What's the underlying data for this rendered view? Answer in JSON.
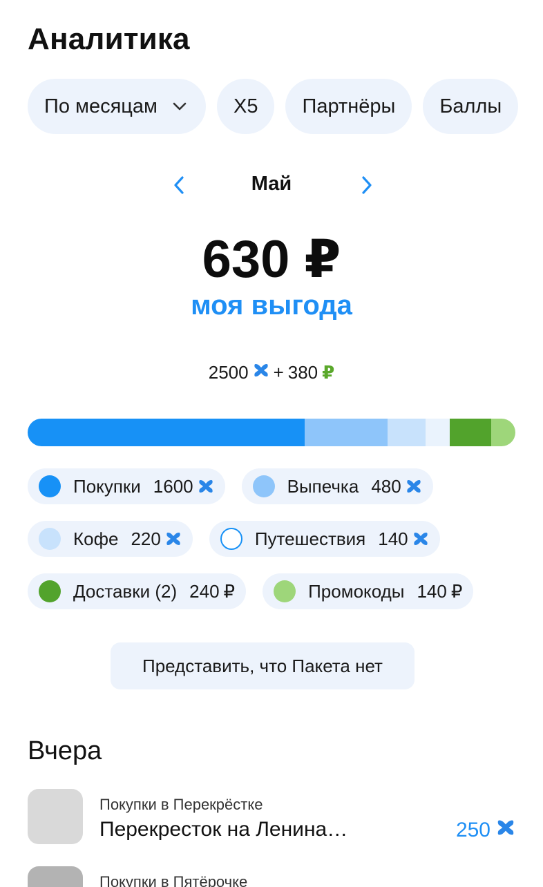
{
  "page": {
    "title": "Аналитика"
  },
  "filters": [
    {
      "label": "По месяцам",
      "dropdown": true
    },
    {
      "label": "X5"
    },
    {
      "label": "Партнёры"
    },
    {
      "label": "Баллы"
    }
  ],
  "month": {
    "label": "Май"
  },
  "summary": {
    "amount": "630 ₽",
    "subtitle": "моя выгода",
    "points": "2500",
    "plus": "+",
    "rubles": "380",
    "rub_sign": "₽"
  },
  "bar_segments": [
    {
      "category": "Покупки",
      "value": 1600,
      "color": "#1791F6"
    },
    {
      "category": "Выпечка",
      "value": 480,
      "color": "#8EC5FA"
    },
    {
      "category": "Кофе",
      "value": 220,
      "color": "#C8E2FC"
    },
    {
      "category": "Путешествия",
      "value": 140,
      "color": "#EAF3FD"
    },
    {
      "category": "Доставки",
      "value": 240,
      "color": "#52A32C"
    },
    {
      "category": "Промокоды",
      "value": 140,
      "color": "#9ED67A"
    }
  ],
  "legend": [
    {
      "label": "Покупки",
      "value": "1600",
      "unit": "points",
      "color": "#1791F6",
      "style": "filled"
    },
    {
      "label": "Выпечка",
      "value": "480",
      "unit": "points",
      "color": "#8EC5FA",
      "style": "filled"
    },
    {
      "label": "Кофе",
      "value": "220",
      "unit": "points",
      "color": "#C8E2FC",
      "style": "filled"
    },
    {
      "label": "Путешествия",
      "value": "140",
      "unit": "points",
      "color": "#1791F6",
      "style": "outline"
    },
    {
      "label": "Доставки (2)",
      "value": "240",
      "unit": "₽",
      "color": "#52A32C",
      "style": "filled"
    },
    {
      "label": "Промокоды",
      "value": "140",
      "unit": "₽",
      "color": "#9ED67A",
      "style": "filled"
    }
  ],
  "action": {
    "label": "Представить, что Пакета нет"
  },
  "section": {
    "title": "Вчера"
  },
  "transactions": [
    {
      "category": "Покупки в Перекрёстке",
      "name": "Перекресток на Ленина…",
      "amount": "250",
      "unit": "points",
      "thumb_color": "#D9D9D9"
    },
    {
      "category": "Покупки в Пятёрочке",
      "name": "",
      "amount": "",
      "unit": "",
      "thumb_color": "#B3B3B3"
    }
  ],
  "colors": {
    "accent": "#1F8FF5",
    "chip_bg": "#EDF3FC",
    "green": "#5AA82B"
  },
  "icons": {
    "points": "x5-points-icon",
    "prev": "chevron-left-icon",
    "next": "chevron-right-icon",
    "dropdown": "chevron-down-icon"
  }
}
